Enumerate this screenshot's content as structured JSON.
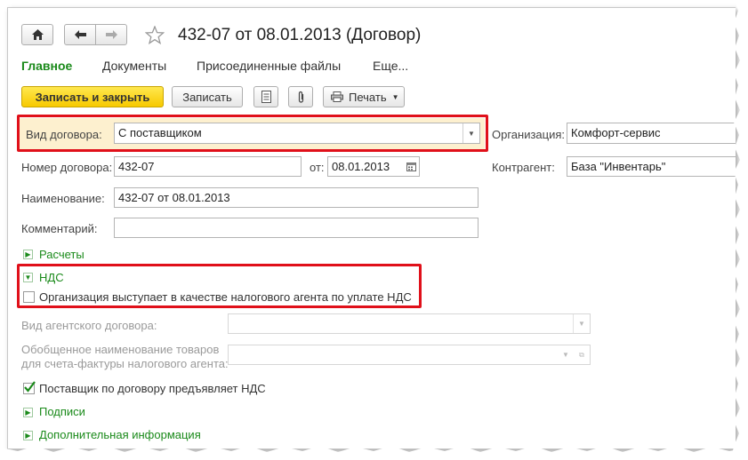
{
  "toolbar_top": {
    "home_icon": "home-icon",
    "back_icon": "arrow-left-icon",
    "forward_icon": "arrow-right-icon",
    "star_icon": "star-icon",
    "title": "432-07 от 08.01.2013 (Договор)"
  },
  "tabs": [
    {
      "label": "Главное"
    },
    {
      "label": "Документы"
    },
    {
      "label": "Присоединенные файлы"
    },
    {
      "label": "Еще..."
    }
  ],
  "actions": {
    "save_close": "Записать и закрыть",
    "save": "Записать",
    "print": "Печать"
  },
  "form": {
    "contract_kind_label": "Вид договора:",
    "contract_kind_value": "С поставщиком",
    "organization_label": "Организация:",
    "organization_value": "Комфорт-сервис",
    "number_label": "Номер договора:",
    "number_value": "432-07",
    "date_label": "от:",
    "date_value": "08.01.2013",
    "counterparty_label": "Контрагент:",
    "counterparty_value": "База \"Инвентарь\"",
    "name_label": "Наименование:",
    "name_value": "432-07 от 08.01.2013",
    "comment_label": "Комментарий:",
    "comment_value": ""
  },
  "groups": {
    "settlements": "Расчеты",
    "vat": "НДС",
    "tax_agent_checkbox": "Организация выступает в качестве налогового агента по уплате НДС",
    "agent_contract_kind_label": "Вид агентского договора:",
    "goods_name_label_line1": "Обобщенное наименование товаров",
    "goods_name_label_line2": "для счета-фактуры налогового агента:",
    "supplier_vat_checkbox": "Поставщик по договору предъявляет НДС",
    "signatures": "Подписи",
    "additional_info": "Дополнительная информация"
  },
  "states": {
    "tax_agent_checked": false,
    "supplier_vat_checked": true
  },
  "colors": {
    "accent_green": "#1a8a1a",
    "highlight_red": "#e0101a",
    "primary_button": "#f7c900"
  }
}
